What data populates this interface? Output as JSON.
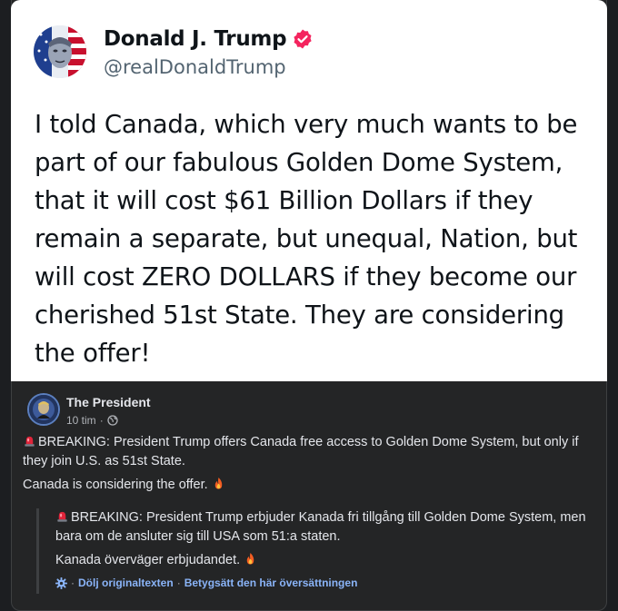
{
  "tweet": {
    "name": "Donald J. Trump",
    "handle": "@realDonaldTrump",
    "text": "I told Canada, which very much wants to be part of our fabulous Golden Dome System, that it will cost $61 Billion Dollars if they remain a separate, but unequal, Nation, but will cost ZERO DOLLARS if they become our cherished 51st State. They are considering the offer!",
    "verified_icon": "verified-badge-icon",
    "verified_color": "#f4245e"
  },
  "post": {
    "author": "The President",
    "time": "10 tim",
    "dot": "·",
    "audience_icon": "globe-icon",
    "paragraph1": "BREAKING: President Trump offers Canada free access to Golden Dome System, but only if they join U.S. as 51st State.",
    "paragraph2": "Canada is considering the offer.",
    "siren_icon": "siren-icon",
    "fire_icon": "fire-icon"
  },
  "translation": {
    "paragraph1": "BREAKING: President Trump erbjuder Kanada fri tillgång till Golden Dome System, men bara om de ansluter sig till USA som 51:a staten.",
    "paragraph2": "Kanada överväger erbjudandet.",
    "hide_original": "Dölj originaltexten",
    "rate_translation": "Betygsätt den här översättningen",
    "separator": "·",
    "link_color": "#8ab4f8"
  },
  "colors": {
    "background": "#242526",
    "text": "#e4e6eb",
    "muted": "#b0b3b8"
  }
}
